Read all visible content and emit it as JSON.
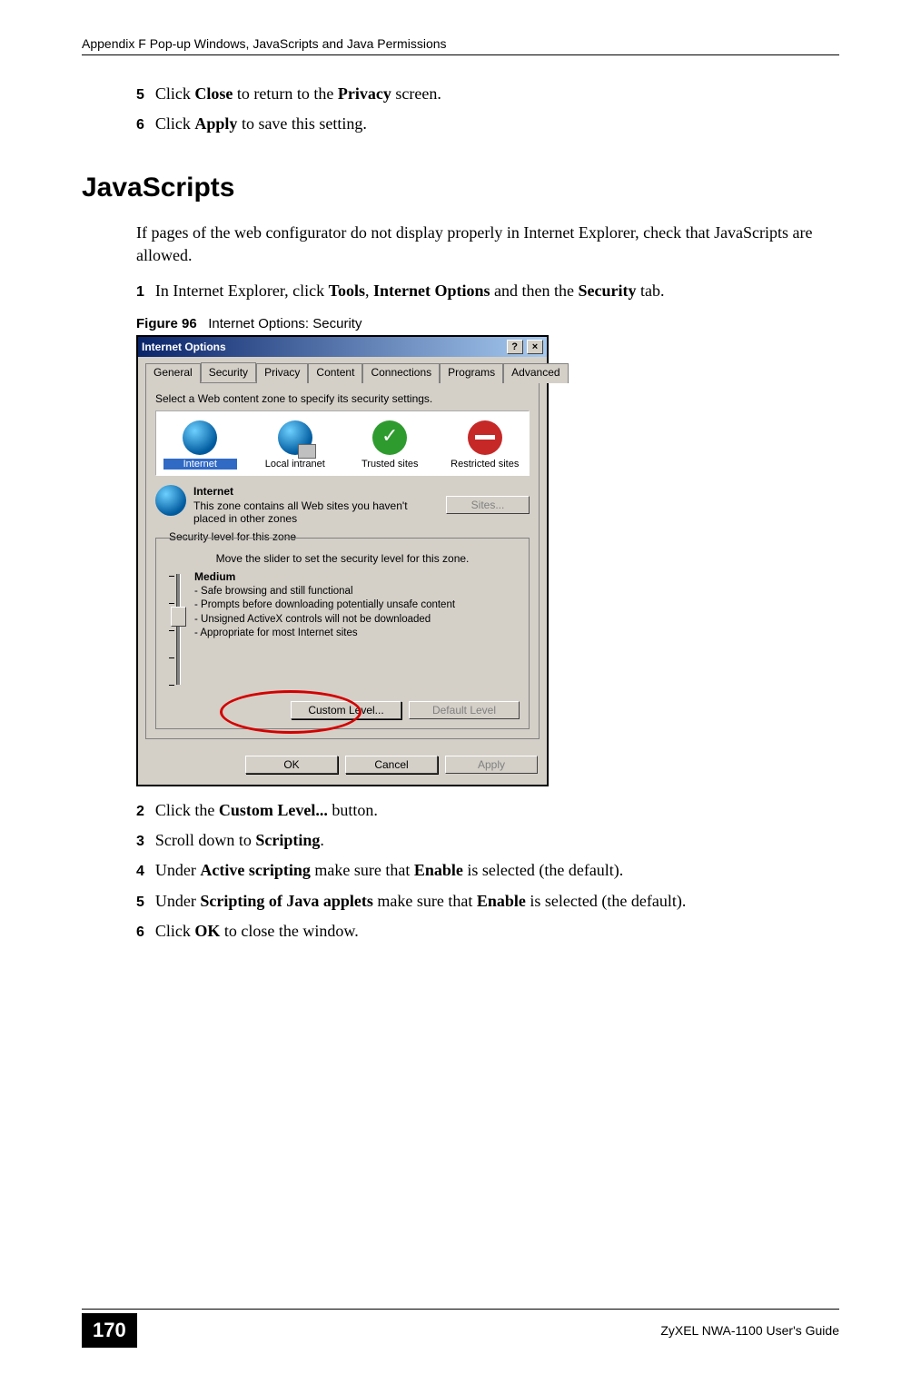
{
  "header": "Appendix F Pop-up Windows, JavaScripts and Java Permissions",
  "intro_steps": [
    {
      "num": "5",
      "parts": [
        "Click ",
        "Close",
        " to return to the ",
        "Privacy",
        " screen."
      ]
    },
    {
      "num": "6",
      "parts": [
        "Click ",
        "Apply",
        " to save this setting."
      ]
    }
  ],
  "section_heading": "JavaScripts",
  "section_intro": "If pages of the web configurator do not display properly in Internet Explorer, check that JavaScripts are allowed.",
  "pre_figure_step": {
    "num": "1",
    "parts": [
      "In Internet Explorer, click ",
      "Tools",
      ", ",
      "Internet Options",
      " and then the ",
      "Security",
      " tab."
    ]
  },
  "figure_caption": {
    "label": "Figure 96",
    "text": "Internet Options: Security"
  },
  "dialog": {
    "title": "Internet Options",
    "tabs": [
      "General",
      "Security",
      "Privacy",
      "Content",
      "Connections",
      "Programs",
      "Advanced"
    ],
    "active_tab": "Security",
    "zone_instruction": "Select a Web content zone to specify its security settings.",
    "zones": [
      {
        "name": "Internet",
        "selected": true
      },
      {
        "name": "Local intranet",
        "selected": false
      },
      {
        "name": "Trusted sites",
        "selected": false
      },
      {
        "name": "Restricted sites",
        "selected": false
      }
    ],
    "zone_detail": {
      "title": "Internet",
      "desc": "This zone contains all Web sites you haven't placed in other zones",
      "sites_btn": "Sites..."
    },
    "groupbox_legend": "Security level for this zone",
    "slider_hint": "Move the slider to set the security level for this zone.",
    "level_name": "Medium",
    "bullets": [
      "- Safe browsing and still functional",
      "- Prompts before downloading potentially unsafe content",
      "- Unsigned ActiveX controls will not be downloaded",
      "- Appropriate for most Internet sites"
    ],
    "custom_level_btn": "Custom Level...",
    "default_level_btn": "Default Level",
    "ok_btn": "OK",
    "cancel_btn": "Cancel",
    "apply_btn": "Apply"
  },
  "post_steps": [
    {
      "num": "2",
      "parts": [
        "Click the ",
        "Custom Level...",
        " button."
      ]
    },
    {
      "num": "3",
      "parts": [
        "Scroll down to ",
        "Scripting",
        "."
      ]
    },
    {
      "num": "4",
      "parts": [
        "Under ",
        "Active scripting",
        " make sure that ",
        "Enable",
        " is selected (the default)."
      ]
    },
    {
      "num": "5",
      "parts": [
        "Under ",
        "Scripting of Java applets",
        " make sure that ",
        "Enable",
        " is selected (the default)."
      ]
    },
    {
      "num": "6",
      "parts": [
        "Click ",
        "OK",
        " to close the window."
      ]
    }
  ],
  "footer": {
    "page_number": "170",
    "guide": "ZyXEL NWA-1100 User's Guide"
  }
}
